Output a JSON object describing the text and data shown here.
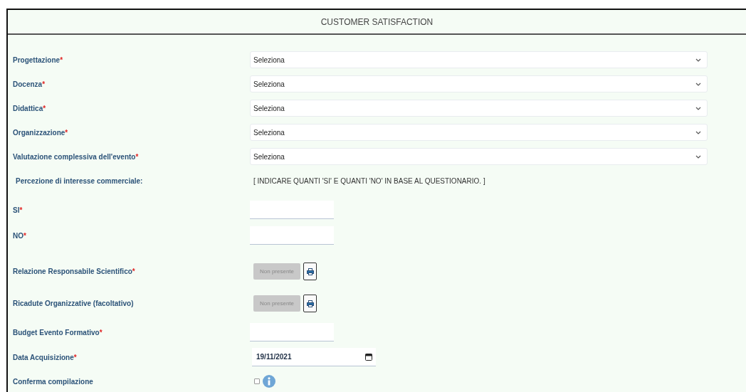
{
  "panel": {
    "title": "CUSTOMER SATISFACTION"
  },
  "rows": [
    {
      "kind": "select",
      "label": "Progettazione",
      "required_mark": "*",
      "value": "Seleziona"
    },
    {
      "kind": "select",
      "label": "Docenza",
      "required_mark": "*",
      "value": "Seleziona"
    },
    {
      "kind": "select",
      "label": "Didattica",
      "required_mark": "*",
      "value": "Seleziona"
    },
    {
      "kind": "select",
      "label": "Organizzazione",
      "required_mark": "*",
      "value": "Seleziona"
    },
    {
      "kind": "select",
      "label": "Valutazione complessiva dell'evento",
      "required_mark": "*",
      "value": "Seleziona"
    },
    {
      "kind": "note",
      "label": "Percezione di interesse commerciale:",
      "note": "[ INDICARE QUANTI 'SI' E QUANTI 'NO' IN BASE AL QUESTIONARIO. ]"
    },
    {
      "kind": "text",
      "label": "SI",
      "required_mark": "*"
    },
    {
      "kind": "text",
      "label": "NO",
      "required_mark": "*"
    },
    {
      "kind": "file",
      "label": "Relazione Responsabile Scientifico",
      "required_mark": "*",
      "button": "Non presente",
      "disabled": true
    },
    {
      "kind": "file",
      "label": "Ricadute Organizzative (facoltativo)",
      "button": "Non presente",
      "disabled": true
    },
    {
      "kind": "text",
      "label": "Budget Evento Formativo",
      "required_mark": "*"
    },
    {
      "kind": "date",
      "label": "Data Acquisizione",
      "required_mark": "*",
      "value": "19/11/2021"
    },
    {
      "kind": "checkbox",
      "label": "Conferma compilazione",
      "checked": false
    }
  ]
}
